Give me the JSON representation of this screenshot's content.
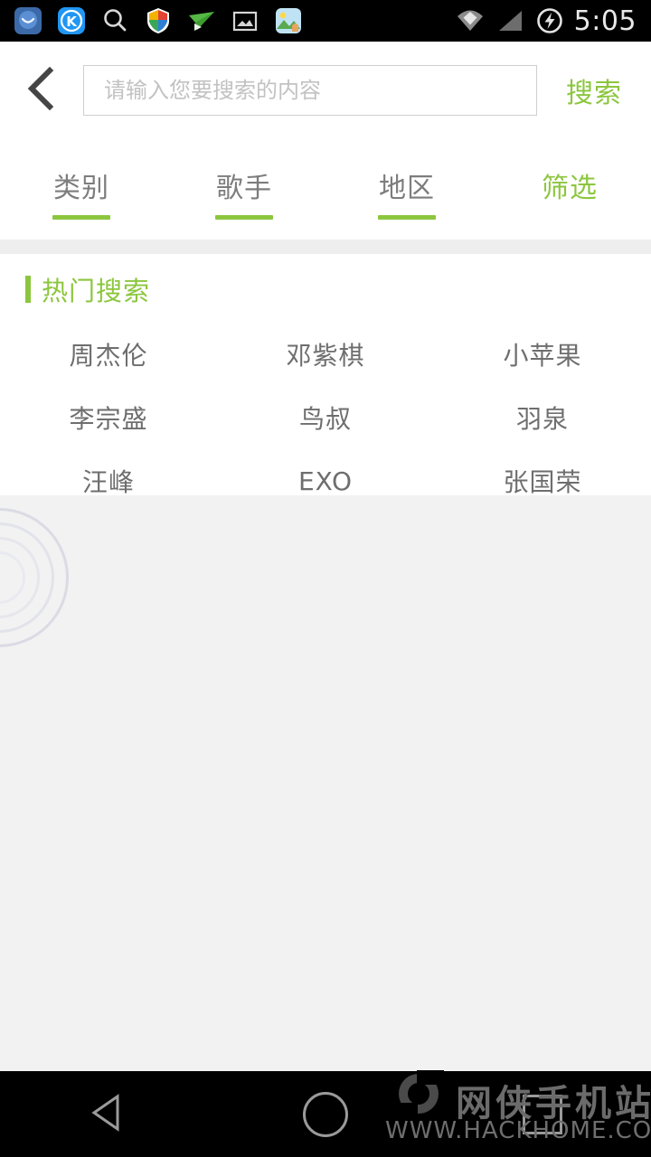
{
  "statusbar": {
    "time": "5:05",
    "left_icons": [
      {
        "name": "chat-app-icon",
        "glyph": "●"
      },
      {
        "name": "kingsoft-k-app-icon",
        "glyph": "K"
      },
      {
        "name": "search-icon",
        "glyph": "⌕"
      },
      {
        "name": "security-shield-icon",
        "glyph": "◆"
      },
      {
        "name": "paper-plane-icon",
        "glyph": "➤"
      },
      {
        "name": "image-icon",
        "glyph": "▣"
      },
      {
        "name": "gallery-icon",
        "glyph": "▦"
      }
    ],
    "right_icons": [
      {
        "name": "wifi-icon"
      },
      {
        "name": "cellular-signal-icon"
      },
      {
        "name": "battery-charging-icon"
      }
    ]
  },
  "header": {
    "back_label": "〈",
    "search_placeholder": "请输入您要搜索的内容",
    "search_value": "",
    "search_button": "搜索"
  },
  "tabs": [
    {
      "label": "类别",
      "underline": true,
      "accent": false
    },
    {
      "label": "歌手",
      "underline": true,
      "accent": false
    },
    {
      "label": "地区",
      "underline": true,
      "accent": false
    },
    {
      "label": "筛选",
      "underline": false,
      "accent": true
    }
  ],
  "hot_search": {
    "title": "热门搜索",
    "items": [
      "周杰伦",
      "邓紫棋",
      "小苹果",
      "李宗盛",
      "鸟叔",
      "羽泉",
      "汪峰",
      "EXO",
      "张国荣"
    ]
  },
  "navbar": {
    "back_label": "back-triangle",
    "home_label": "home-circle",
    "recent_label": "recents-square"
  },
  "watermark": {
    "site_name": "网侠手机站",
    "site_url": "WWW.HACKHOME.COM"
  },
  "colors": {
    "accent_green": "#8cc63e",
    "tab_gray": "#7d7d7d",
    "item_gray": "#6e6e6e",
    "page_bg": "#f2f2f2",
    "card_bg": "#ffffff",
    "statusbar_bg": "#000000"
  }
}
